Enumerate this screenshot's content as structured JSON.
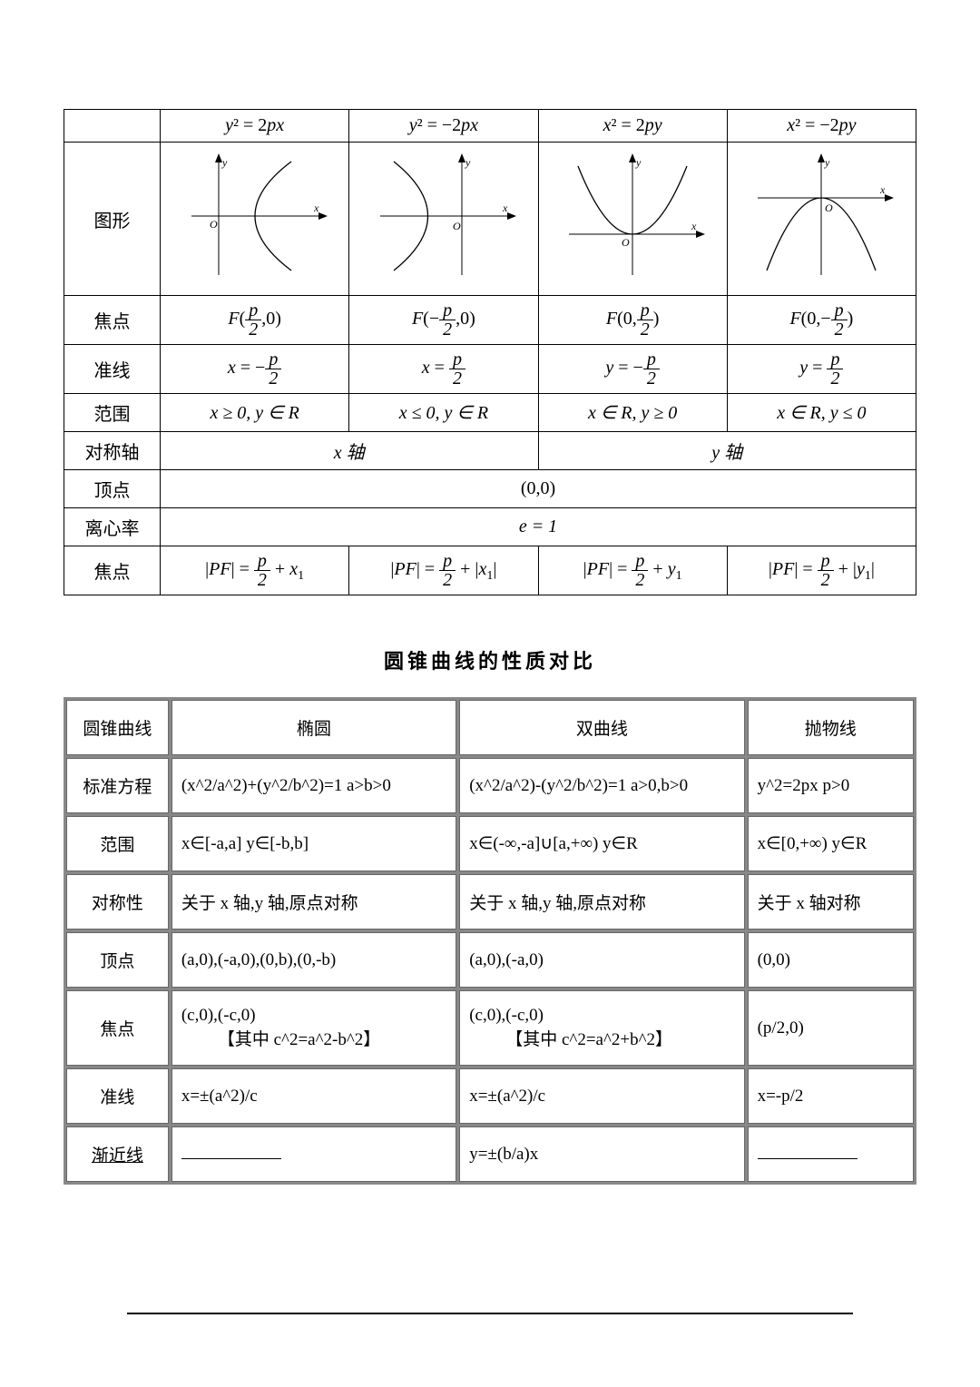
{
  "t1": {
    "eq1": "y² = 2px",
    "eq2": "y² = −2px",
    "eq3": "x² = 2py",
    "eq4": "x² = −2py",
    "row_shape": "图形",
    "row_focus": "焦点",
    "row_directrix": "准线",
    "row_range": "范围",
    "row_axis": "对称轴",
    "row_vertex": "顶点",
    "row_ecc": "离心率",
    "row_focal": "焦点",
    "range1": "x ≥ 0, y ∈ R",
    "range2": "x ≤ 0, y ∈ R",
    "range3": "x ∈ R, y ≥ 0",
    "range4": "x ∈ R, y ≤ 0",
    "axis_x": "x 轴",
    "axis_y": "y 轴",
    "vertex_all": "(0,0)",
    "ecc_all": "e = 1"
  },
  "title2": "圆锥曲线的性质对比",
  "t2": {
    "h0": "圆锥曲线",
    "h1": "椭圆",
    "h2": "双曲线",
    "h3": "抛物线",
    "r1": "标准方程",
    "r1c1": "(x^2/a^2)+(y^2/b^2)=1  a>b>0",
    "r1c2": "(x^2/a^2)-(y^2/b^2)=1  a>0,b>0",
    "r1c3": "y^2=2px  p>0",
    "r2": "范围",
    "r2c1": "x∈[-a,a]        y∈[-b,b]",
    "r2c2": "x∈(-∞,-a]∪[a,+∞)      y∈R",
    "r2c3": "x∈[0,+∞)  y∈R",
    "r3": "对称性",
    "r3c1": "关于 x 轴,y 轴,原点对称",
    "r3c2": "关于 x 轴,y 轴,原点对称",
    "r3c3": "关于 x 轴对称",
    "r4": "顶点",
    "r4c1": "(a,0),(-a,0),(0,b),(0,-b)",
    "r4c2": "(a,0),(-a,0)",
    "r4c3": "(0,0)",
    "r5": "焦点",
    "r5c1a": "(c,0),(-c,0)",
    "r5c1b": "【其中 c^2=a^2-b^2】",
    "r5c2a": "(c,0),(-c,0)",
    "r5c2b": "【其中 c^2=a^2+b^2】",
    "r5c3": "(p/2,0)",
    "r6": "准线",
    "r6c1": "x=±(a^2)/c",
    "r6c2": "x=±(a^2)/c",
    "r6c3": "x=-p/2",
    "r7": "渐近线",
    "r7c2": "y=±(b/a)x"
  }
}
